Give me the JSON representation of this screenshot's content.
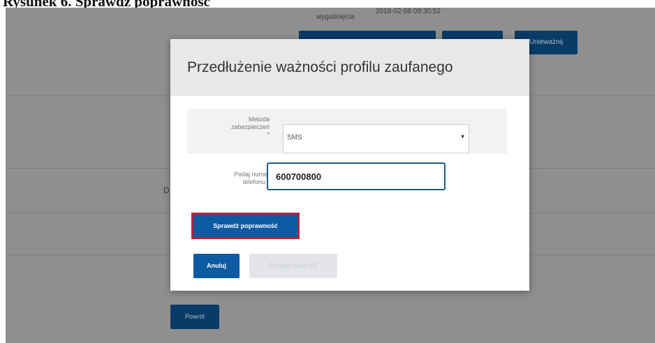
{
  "caption": "Rysunek 6. Sprawdź poprawność",
  "background": {
    "expiry_label": "wygaśnięcia",
    "expiry_value": "2018-02-08 09:30:52",
    "revoke_button": "Unieważnij",
    "partial_letter": "D",
    "back_button": "Powrót"
  },
  "modal": {
    "title": "Przedłużenie ważności profilu zaufanego",
    "security_method": {
      "label_line1": "Metoda",
      "label_line2": "zabezpieczeń",
      "label_line3": "*",
      "value": "SMS",
      "caret": "▾"
    },
    "phone": {
      "label_line1": "Podaj numer",
      "label_line2": "telefonu *",
      "value": "600700800"
    },
    "verify_button": "Sprawdź poprawność",
    "cancel_button": "Anuluj",
    "sign_button": "Podpisz nowy PZ"
  },
  "colors": {
    "primary_button": "#0d5ba3",
    "highlight_border": "#b4243a",
    "overlay": "#8f8f8f"
  }
}
